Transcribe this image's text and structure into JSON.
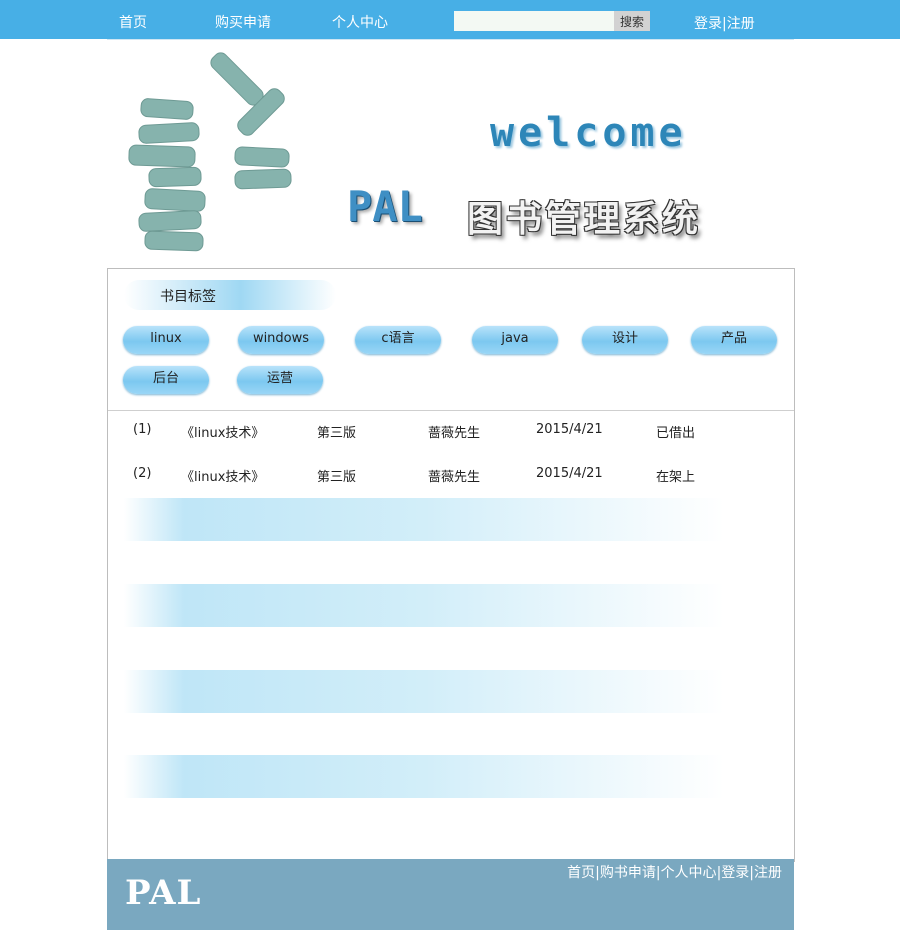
{
  "nav": {
    "items": [
      "首页",
      "购买申请",
      "个人中心"
    ],
    "search_button": "搜索",
    "login": "登录",
    "separator": "|",
    "register": "注册"
  },
  "hero": {
    "welcome": "welcome",
    "brand": "PAL",
    "system_title": "图书管理系统"
  },
  "tags": {
    "header": "书目标签",
    "items": [
      "linux",
      "windows",
      "c语言",
      "java",
      "设计",
      "产品",
      "后台",
      "运营"
    ]
  },
  "books": [
    {
      "index": "(1)",
      "title": "《linux技术》",
      "edition": "第三版",
      "author": "蔷薇先生",
      "date": "2015/4/21",
      "status": "已借出"
    },
    {
      "index": "(2)",
      "title": "《linux技术》",
      "edition": "第三版",
      "author": "蔷薇先生",
      "date": "2015/4/21",
      "status": "在架上"
    }
  ],
  "footer": {
    "logo": "PAL",
    "links": [
      "首页",
      "购书申请",
      "个人中心",
      "登录",
      "注册"
    ],
    "separator": "|"
  },
  "colors": {
    "topbar": "#47afe6",
    "tag": "#7cc8f0",
    "footer": "#7aa8c0",
    "book_icon": "#86b3ad"
  }
}
